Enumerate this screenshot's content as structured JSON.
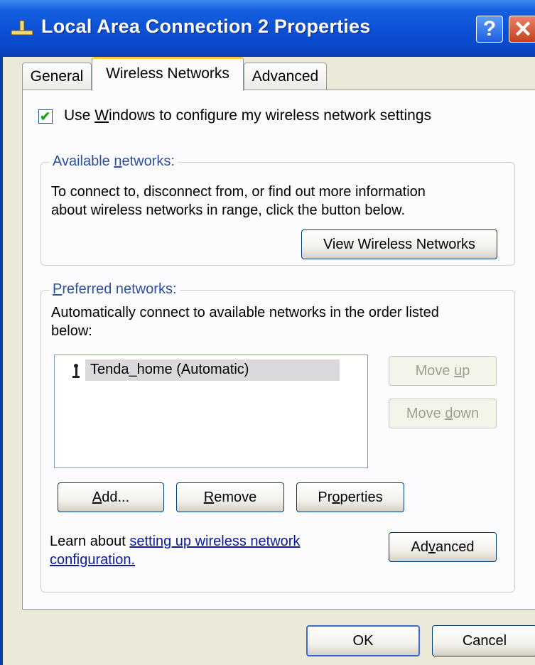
{
  "window": {
    "title": "Local Area Connection 2 Properties",
    "help_button": "?",
    "close_button": "✕",
    "title_icon": "network-connection-icon"
  },
  "tabs": [
    {
      "label": "General",
      "active": false
    },
    {
      "label": "Wireless Networks",
      "active": true
    },
    {
      "label": "Advanced",
      "active": false
    }
  ],
  "wireless": {
    "use_windows_checkbox": {
      "label": "Use Windows to configure my wireless network settings",
      "checked": true
    },
    "available": {
      "legend": "Available networks:",
      "description_line1": "To connect to, disconnect from, or find out more information",
      "description_line2": "about wireless networks in range, click the button below.",
      "view_button": "View Wireless Networks"
    },
    "preferred": {
      "legend": "Preferred networks:",
      "description_line1": "Automatically connect to available networks in the order listed",
      "description_line2": "below:",
      "networks": [
        {
          "name": "Tenda_home (Automatic)",
          "icon": "wireless-antenna-icon",
          "selected": true
        }
      ],
      "move_up_button": "Move up",
      "move_down_button": "Move down",
      "add_button": "Add...",
      "remove_button": "Remove",
      "properties_button": "Properties",
      "learn_prefix": "Learn about ",
      "learn_link_line1": "setting up wireless network",
      "learn_link_line2": "configuration.",
      "advanced_button": "Advanced"
    }
  },
  "footer": {
    "ok_button": "OK",
    "cancel_button": "Cancel"
  },
  "colors": {
    "titlebar": "#0b4fd4",
    "dialog_bg": "#ece9d8",
    "panel_bg": "#fcfcfe",
    "group_legend": "#2c4fa0",
    "link": "#0a1a9f",
    "active_tab_accent": "#ffc83c"
  }
}
